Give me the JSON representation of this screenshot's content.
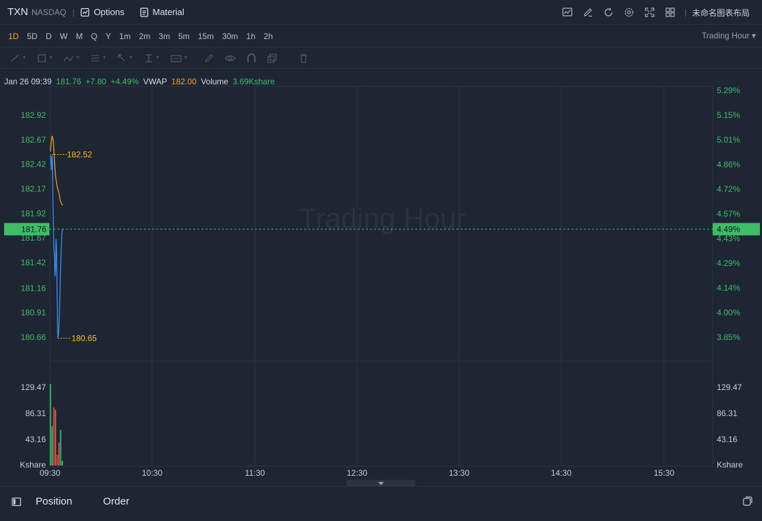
{
  "header": {
    "symbol": "TXN",
    "exchange": "NASDAQ",
    "divider": "|",
    "options_label": "Options",
    "material_label": "Material",
    "layout_name": "未命名图表布局",
    "icons": [
      "chart-indicator-icon",
      "draw-pen-icon",
      "refresh-icon",
      "settings-gear-icon",
      "fullscreen-icon",
      "layout-grid-icon"
    ]
  },
  "periods": [
    "1D",
    "5D",
    "D",
    "W",
    "M",
    "Q",
    "Y",
    "1m",
    "2m",
    "3m",
    "5m",
    "15m",
    "30m",
    "1h",
    "2h"
  ],
  "active_period": "1D",
  "trading_hour_select": "Trading Hour ▾",
  "info": {
    "datetime": "Jan 26 09:39",
    "price": "181.76",
    "change": "+7.80",
    "change_pct": "+4.49%",
    "vwap_label": "VWAP",
    "vwap_value": "182.00",
    "volume_label": "Volume",
    "volume_value": "3.69Kshare"
  },
  "watermark": "Trading Hour",
  "colors": {
    "price_line": "#3d8ef0",
    "vwap_line": "#f5a623",
    "up": "#3dbd6a",
    "down": "#e0534a",
    "background": "#1f2633"
  },
  "chart_data": {
    "type": "line",
    "price_axis_left": [
      "182.92",
      "182.67",
      "182.42",
      "182.17",
      "181.92",
      "181.67",
      "181.42",
      "181.16",
      "180.91",
      "180.66"
    ],
    "percent_axis_right": [
      "5.29%",
      "5.15%",
      "5.01%",
      "4.86%",
      "4.72%",
      "4.57%",
      "4.43%",
      "4.29%",
      "4.14%",
      "4.00%",
      "3.85%"
    ],
    "volume_axis": [
      "129.47",
      "86.31",
      "43.16"
    ],
    "volume_unit": "Kshare",
    "x_ticks": [
      "09:30",
      "10:30",
      "11:30",
      "12:30",
      "13:30",
      "14:30",
      "15:30"
    ],
    "current_price_label": "181.76",
    "current_pct_label": "4.49%",
    "high_marker": "182.52",
    "low_marker": "180.65",
    "ylim": [
      180.66,
      182.92
    ],
    "price_series": {
      "name": "Price",
      "minutes": [
        0,
        0.3,
        0.6,
        0.9,
        1.2,
        1.5,
        1.8,
        2.1,
        2.4,
        2.7,
        3.0,
        3.3,
        3.6,
        4.0,
        4.4,
        4.8,
        5.2,
        5.6,
        6.0,
        6.4,
        6.8,
        7.2
      ],
      "values": [
        182.52,
        182.45,
        182.36,
        182.51,
        182.44,
        182.06,
        181.78,
        181.55,
        181.48,
        181.28,
        181.34,
        181.66,
        181.57,
        181.06,
        180.65,
        180.69,
        180.84,
        181.06,
        181.35,
        181.58,
        181.72,
        181.76
      ]
    },
    "vwap_series": {
      "name": "VWAP",
      "minutes": [
        0,
        0.5,
        1.0,
        1.5,
        2.0,
        2.5,
        3.0,
        3.5,
        4.0,
        5.0,
        6.0,
        7.2
      ],
      "values": [
        182.55,
        182.65,
        182.71,
        182.68,
        182.58,
        182.43,
        182.3,
        182.25,
        182.19,
        182.13,
        182.04,
        182.0
      ]
    },
    "volume_bars": {
      "minutes": [
        0,
        1,
        2,
        3,
        4,
        5,
        6,
        7
      ],
      "values": [
        135.0,
        65.0,
        96.0,
        92.0,
        18.0,
        38.0,
        59.0,
        8.0
      ],
      "direction": [
        "up",
        "up",
        "down",
        "down",
        "down",
        "down",
        "up",
        "up"
      ]
    }
  },
  "footer": {
    "position_label": "Position",
    "order_label": "Order"
  }
}
